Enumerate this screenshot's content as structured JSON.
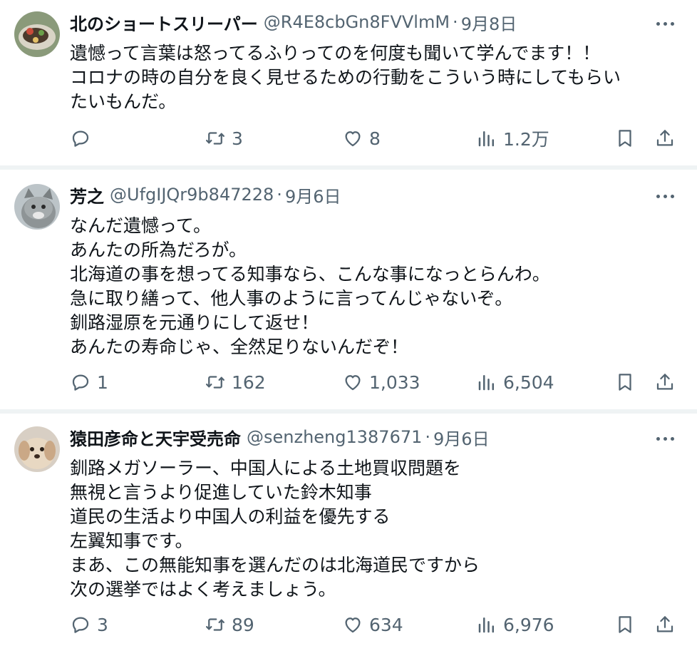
{
  "tweets": [
    {
      "name": "北のショートスリーパー",
      "handle": "@R4E8cbGn8FVVlmM",
      "date": "9月8日",
      "lines": [
        "遺憾って言葉は怒ってるふりってのを何度も聞いて学んでます！！",
        "コロナの時の自分を良く見せるための行動をこういう時にしてもらい",
        "たいもんだ。"
      ],
      "reply_count": "",
      "retweet_count": "3",
      "like_count": "8",
      "view_count": "1.2万"
    },
    {
      "name": "芳之",
      "handle": "@UfgIJQr9b847228",
      "date": "9月6日",
      "lines": [
        "なんだ遺憾って。",
        "あんたの所為だろが。",
        "北海道の事を想ってる知事なら、こんな事になっとらんわ。",
        "急に取り繕って、他人事のように言ってんじゃないぞ。",
        "釧路湿原を元通りにして返せ！",
        "あんたの寿命じゃ、全然足りないんだぞ！"
      ],
      "reply_count": "1",
      "retweet_count": "162",
      "like_count": "1,033",
      "view_count": "6,504"
    },
    {
      "name": "猿田彦命と天宇受売命",
      "handle": "@senzheng1387671",
      "date": "9月6日",
      "lines": [
        "釧路メガソーラー、中国人による土地買収問題を",
        "無視と言うより促進していた鈴木知事",
        "道民の生活より中国人の利益を優先する",
        "左翼知事です。",
        "まあ、この無能知事を選んだのは北海道民ですから",
        "次の選挙ではよく考えましょう。"
      ],
      "reply_count": "3",
      "retweet_count": "89",
      "like_count": "634",
      "view_count": "6,976"
    }
  ],
  "icons": {
    "reply": "reply-icon",
    "retweet": "retweet-icon",
    "like": "heart-icon",
    "views": "views-icon",
    "bookmark": "bookmark-icon",
    "share": "share-icon",
    "more": "more-icon"
  },
  "colors": {
    "text": "#0f1419",
    "secondary": "#536471",
    "divider": "#eff3f4"
  }
}
